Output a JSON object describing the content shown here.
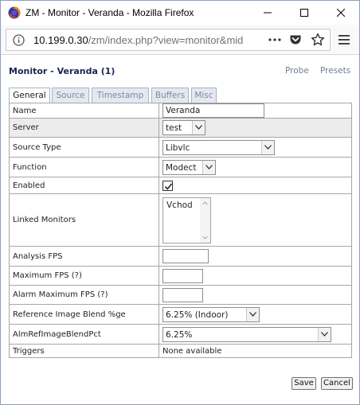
{
  "window": {
    "title": "ZM - Monitor - Veranda - Mozilla Firefox"
  },
  "navbar": {
    "url_host": "10.199.0.30",
    "url_path": "/zm/index.php?view=monitor&mid"
  },
  "page": {
    "title": "Monitor - Veranda (1)",
    "links": {
      "probe": "Probe",
      "presets": "Presets"
    },
    "tabs": [
      "General",
      "Source",
      "Timestamp",
      "Buffers",
      "Misc"
    ],
    "active_tab": "General"
  },
  "form": {
    "name": {
      "label": "Name",
      "value": "Veranda"
    },
    "server": {
      "label": "Server",
      "value": "test"
    },
    "source_type": {
      "label": "Source Type",
      "value": "Libvlc"
    },
    "function": {
      "label": "Function",
      "value": "Modect"
    },
    "enabled": {
      "label": "Enabled",
      "checked": true
    },
    "linked_monitors": {
      "label": "Linked Monitors",
      "options": [
        "Vchod"
      ]
    },
    "analysis_fps": {
      "label": "Analysis FPS",
      "value": ""
    },
    "maximum_fps": {
      "label": "Maximum FPS (?)",
      "value": ""
    },
    "alarm_maximum_fps": {
      "label": "Alarm Maximum FPS (?)",
      "value": ""
    },
    "ref_blend": {
      "label": "Reference Image Blend %ge",
      "value": "6.25% (Indoor)"
    },
    "alm_ref_blend": {
      "label": "AlmRefImageBlendPct",
      "value": "6.25%"
    },
    "triggers": {
      "label": "Triggers",
      "value": "None available"
    }
  },
  "buttons": {
    "save": "Save",
    "cancel": "Cancel"
  },
  "colors": {
    "title_navy": "#1a2555",
    "link_gray": "#6f7f97",
    "tab_inactive": "#e4e8f0"
  }
}
